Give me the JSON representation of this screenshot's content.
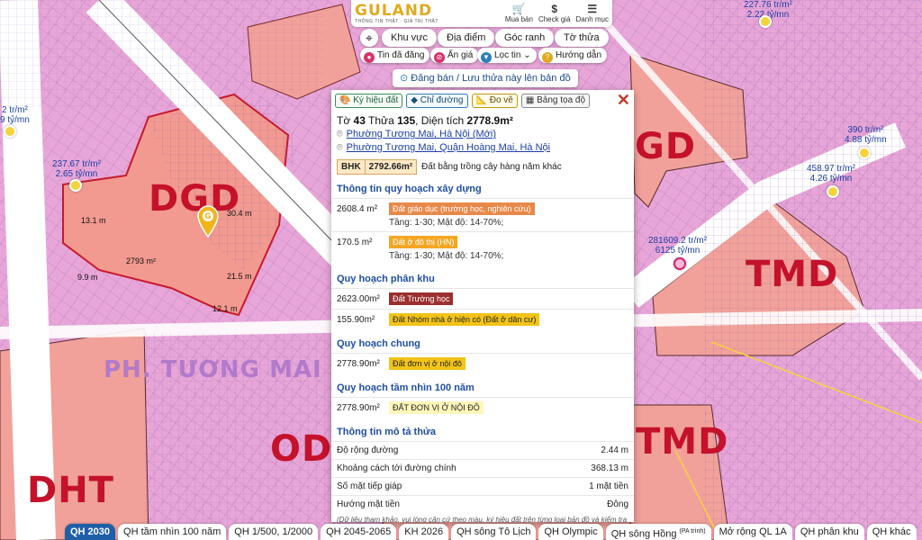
{
  "brand": {
    "name": "GULAND",
    "tagline": "THÔNG TIN THẬT · GIÁ TRỊ THẬT"
  },
  "header_buttons": [
    {
      "icon": "cart-icon",
      "label": "Mua bán"
    },
    {
      "icon": "dollar-icon",
      "label": "Check giá"
    },
    {
      "icon": "menu-icon",
      "label": "Danh mục"
    }
  ],
  "search_tabs": [
    "Khu vực",
    "Địa điểm",
    "Góc ranh",
    "Tờ thửa"
  ],
  "filter_buttons": [
    "Tin đã đăng",
    "Ẩn giá",
    "Lọc tin",
    "Hướng dẫn"
  ],
  "post_button": "Đăng bán / Lưu thửa này lên bản đồ",
  "map": {
    "zone_labels": [
      "DGD",
      "GD",
      "TMD",
      "TMD",
      "DHT",
      "OD",
      "PH. TƯƠNG MAI"
    ],
    "prices": [
      {
        "text1": "227.76 tr/m²",
        "text2": "2.22 tỷ/mn"
      },
      {
        "text1": "2 tr/m²",
        "text2": "9 tỷ/mn"
      },
      {
        "text1": "237.67 tr/m²",
        "text2": "2.65 tỷ/mn"
      },
      {
        "text1": "390 tr/m²",
        "text2": "4.88 tỷ/mn"
      },
      {
        "text1": "458.97 tr/m²",
        "text2": "4.26 tỷ/mn"
      },
      {
        "text1": "281609.2 tr/m²",
        "text2": "6125 tỷ/mn"
      }
    ],
    "dimensions": [
      "13.1 m",
      "2793 m²",
      "9.9 m",
      "21.5 m",
      "12.1 m",
      "30.4 m"
    ]
  },
  "panel": {
    "tools": [
      "Ký hiệu đất",
      "Chỉ đường",
      "Đo vẽ",
      "Bảng tọa độ"
    ],
    "close_label": "✕",
    "title": {
      "prefix": "Tờ",
      "sheet": "43",
      "lot_label": "Thửa",
      "lot": "135",
      "area_label": ", Diện tích",
      "area": "2778.9m²"
    },
    "address_new": {
      "ward": "Phường Tương Mai",
      "city": "Hà Nội (Mới)"
    },
    "address_old": {
      "ward": "Phường Tương Mai",
      "district": "Quận Hoàng Mai",
      "city": "Hà Nội"
    },
    "land_code": "BHK",
    "land_area": "2792.66m²",
    "land_desc": "Đất bằng trồng cây hàng năm khác",
    "sections": {
      "construction": {
        "title": "Thông tin quy hoạch xây dựng",
        "rows": [
          {
            "area": "2608.4 m²",
            "label": "Đất giáo dục (trường học, nghiên cứu)",
            "color": "#e8894a",
            "detail": "Tầng: 1-30; Mật độ: 14-70%;"
          },
          {
            "area": "170.5 m²",
            "label": "Đất ở đô thị (HN)",
            "color": "#f5a623",
            "detail": "Tầng: 1-30; Mật độ: 14-70%;"
          }
        ]
      },
      "zoning": {
        "title": "Quy hoạch phân khu",
        "rows": [
          {
            "area": "2623.00m²",
            "label": "Đất Trường học",
            "color": "#9b2f2f"
          },
          {
            "area": "155.90m²",
            "label": "Đất Nhóm nhà ở hiện có (Đất ở dân cư)",
            "color": "#f2c318"
          }
        ]
      },
      "general": {
        "title": "Quy hoạch chung",
        "rows": [
          {
            "area": "2778.90m²",
            "label": "Đất đơn vị ở nội đô",
            "color": "#f2c318"
          }
        ]
      },
      "vision": {
        "title": "Quy hoạch tầm nhìn 100 năm",
        "rows": [
          {
            "area": "2778.90m²",
            "label": "ĐẤT ĐƠN VỊ Ở NỘI ĐÔ",
            "color": "#fff6b8"
          }
        ]
      },
      "description": {
        "title": "Thông tin mô tả thửa",
        "items": [
          {
            "k": "Độ rộng đường",
            "v": "2.44 m"
          },
          {
            "k": "Khoảng cách tới đường chính",
            "v": "368.13 m"
          },
          {
            "k": "Số mặt tiếp giáp",
            "v": "1 mặt tiền"
          },
          {
            "k": "Hướng mặt tiền",
            "v": "Đông"
          }
        ]
      }
    },
    "note": "(Dữ liệu tham khảo, vui lòng căn cứ theo màu, ký hiệu đất trên từng loại bản đồ và kiểm tra lại với cơ quan chức năng trước khi giao dịch)"
  },
  "bottom_tabs": [
    {
      "label": "QH 2030",
      "active": true
    },
    {
      "label": "QH tầm nhìn 100 năm"
    },
    {
      "label": "QH 1/500, 1/2000"
    },
    {
      "label": "QH 2045-2065"
    },
    {
      "label": "KH 2026"
    },
    {
      "label": "QH sông Tô Lịch"
    },
    {
      "label": "QH Olympic"
    },
    {
      "label": "QH sông Hồng",
      "sup": "(PA trình)"
    },
    {
      "label": "Mở rộng QL 1A"
    },
    {
      "label": "QH phân khu"
    },
    {
      "label": "QH khác"
    }
  ]
}
